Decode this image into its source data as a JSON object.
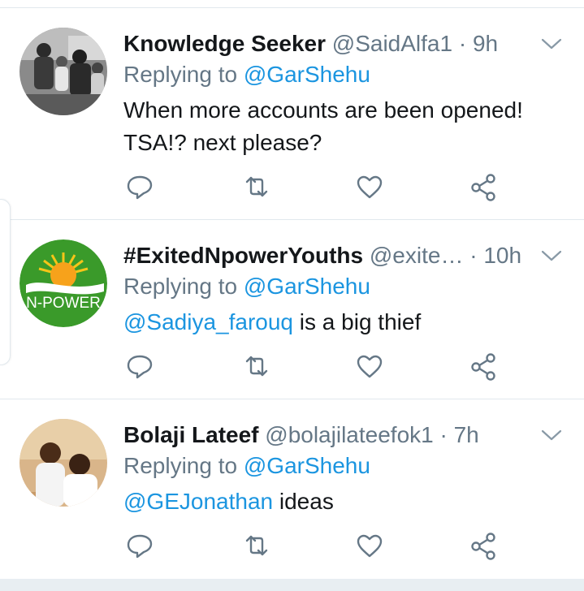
{
  "colors": {
    "link": "#1b95e0",
    "secondary": "#657786",
    "text": "#14171a",
    "divider": "#e1e8ed"
  },
  "tweets": [
    {
      "name": "Knowledge Seeker",
      "handle": "@SaidAlfa1",
      "dot": "·",
      "time": "9h",
      "replying_prefix": "Replying to",
      "replying_to": "@GarShehu",
      "body_line1": "When more accounts are been opened!",
      "body_line2": "TSA!?  next please?",
      "avatar_icon": "black-and-white-family-photo"
    },
    {
      "name": "#ExitedNpowerYouths",
      "handle": "@exite…",
      "dot": "·",
      "time": "10h",
      "replying_prefix": "Replying to",
      "replying_to": "@GarShehu",
      "body_mention": "@Sadiya_farouq",
      "body_text": "is a big thief",
      "avatar_icon": "npower-logo",
      "avatar_text": "N-POWER"
    },
    {
      "name": "Bolaji Lateef",
      "handle": "@bolajilateefok1",
      "dot": "·",
      "time": "7h",
      "replying_prefix": "Replying to",
      "replying_to": "@GarShehu",
      "body_mention": "@GEJonathan",
      "body_text": "ideas",
      "avatar_icon": "two-men-photo"
    }
  ]
}
